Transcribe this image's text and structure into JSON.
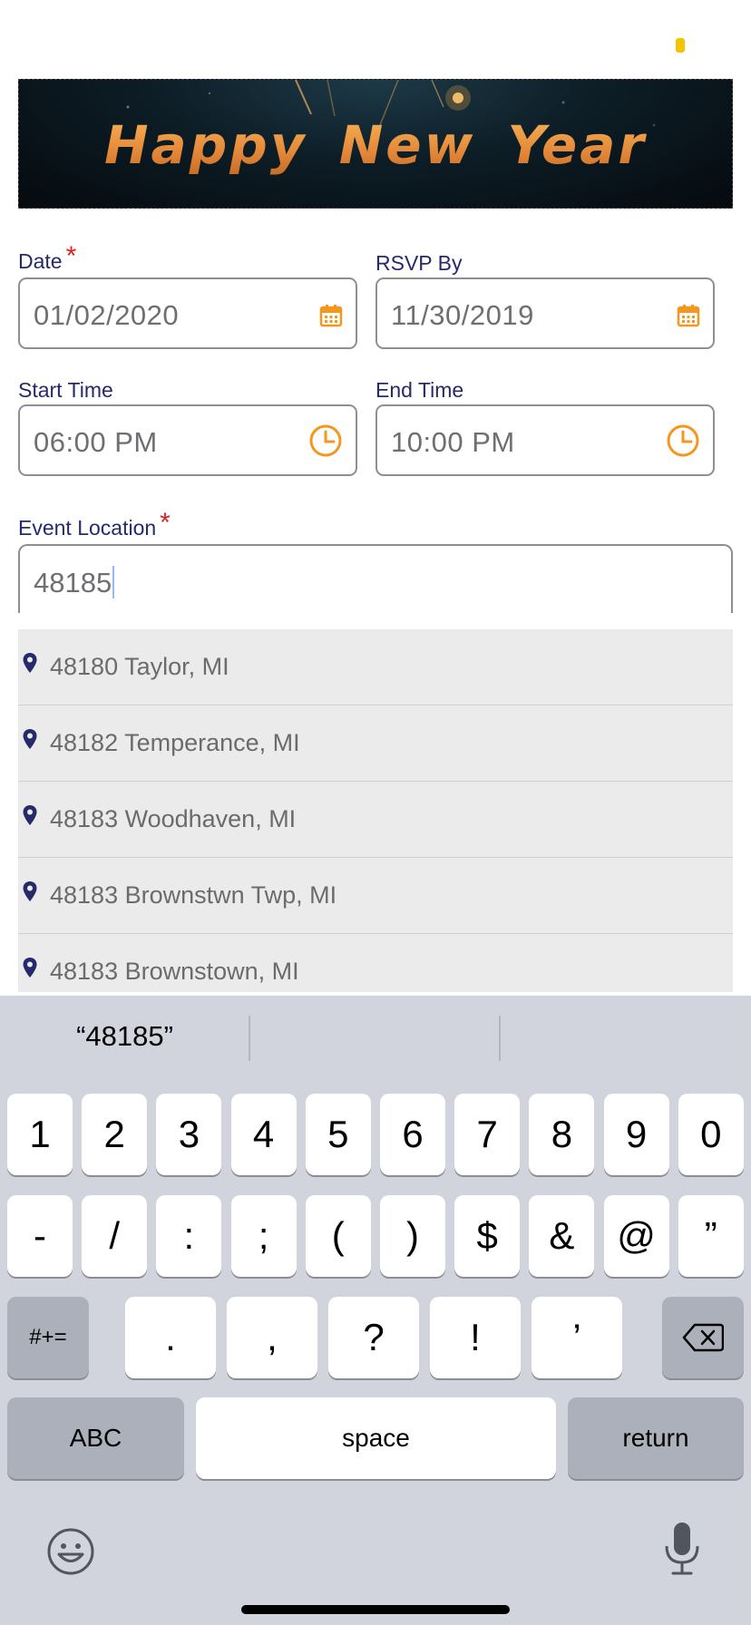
{
  "banner": {
    "title": "Happy New Year"
  },
  "form": {
    "date": {
      "label": "Date",
      "required_mark": "*",
      "value": "01/02/2020",
      "icon": "calendar-icon"
    },
    "rsvp": {
      "label": "RSVP By",
      "value": "11/30/2019",
      "icon": "calendar-icon"
    },
    "start_time": {
      "label": "Start Time",
      "value": "06:00 PM",
      "icon": "clock-icon"
    },
    "end_time": {
      "label": "End Time",
      "value": "10:00 PM",
      "icon": "clock-icon"
    },
    "location": {
      "label": "Event Location",
      "required_mark": "*",
      "value": "48185"
    }
  },
  "suggestions": [
    {
      "text": "48180 Taylor, MI"
    },
    {
      "text": "48182 Temperance, MI"
    },
    {
      "text": "48183 Woodhaven, MI"
    },
    {
      "text": "48183 Brownstwn Twp, MI"
    },
    {
      "text": "48183 Brownstown, MI"
    }
  ],
  "keyboard": {
    "prediction": "“48185”",
    "row1": [
      "1",
      "2",
      "3",
      "4",
      "5",
      "6",
      "7",
      "8",
      "9",
      "0"
    ],
    "row2": [
      "-",
      "/",
      ":",
      ";",
      "(",
      ")",
      "$",
      "&",
      "@",
      "”"
    ],
    "row3": [
      ".",
      ",",
      "?",
      "!",
      "’"
    ],
    "shift_label": "#+=",
    "abc_label": "ABC",
    "space_label": "space",
    "return_label": "return"
  },
  "colors": {
    "accent": "#f5961d",
    "label": "#262a6b",
    "required": "#e02020",
    "pin": "#262a6b"
  }
}
